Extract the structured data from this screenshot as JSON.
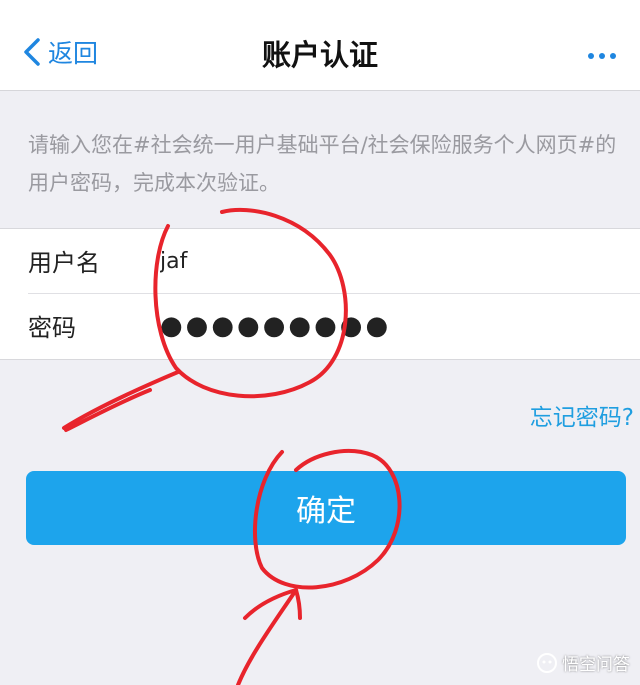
{
  "colors": {
    "accent": "#1f86e0",
    "button": "#1da4ec",
    "background": "#efeff4",
    "annotation": "#e8242c"
  },
  "nav": {
    "back_label": "返回",
    "title": "账户认证",
    "more_icon": "more-dots-icon",
    "back_icon": "chevron-left-icon"
  },
  "hint": {
    "text": "请输入您在#社会统一用户基础平台/社会保险服务个人网页#的用户密码，完成本次验证。"
  },
  "form": {
    "username_label": "用户名",
    "username_value": "jaf",
    "password_label": "密码",
    "password_value": "●●●●●●●●●"
  },
  "forgot_password": "忘记密码?",
  "confirm_button": "确定",
  "watermark": {
    "text": "悟空问答",
    "icon": "wukong-logo-icon"
  }
}
